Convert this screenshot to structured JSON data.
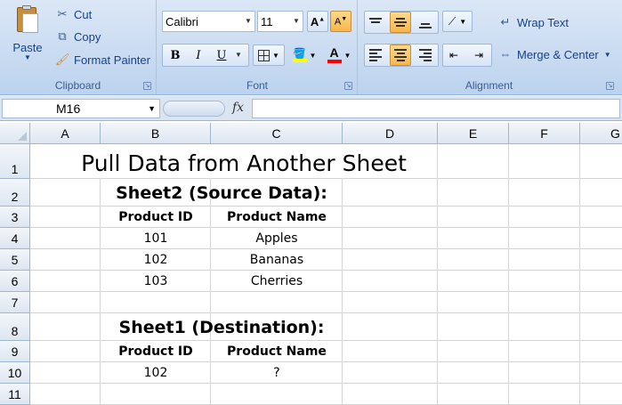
{
  "ribbon": {
    "clipboard": {
      "paste_label": "Paste",
      "cut_label": "Cut",
      "copy_label": "Copy",
      "format_painter_label": "Format Painter",
      "group_label": "Clipboard"
    },
    "font": {
      "font_name": "Calibri",
      "font_size": "11",
      "bold": "B",
      "italic": "I",
      "underline": "U",
      "highlight_color": "#ffff00",
      "font_color": "#ff0000",
      "group_label": "Font"
    },
    "alignment": {
      "wrap_text_label": "Wrap Text",
      "merge_center_label": "Merge & Center",
      "group_label": "Alignment"
    }
  },
  "formula_bar": {
    "name_box": "M16",
    "fx": "fx",
    "formula": ""
  },
  "grid": {
    "columns": [
      "A",
      "B",
      "C",
      "D",
      "E",
      "F",
      "G"
    ],
    "rows": [
      "1",
      "2",
      "3",
      "4",
      "5",
      "6",
      "7",
      "8",
      "9",
      "10",
      "11"
    ],
    "cells": {
      "title": "Pull Data from Another Sheet",
      "sheet2_heading": "Sheet2 (Source Data):",
      "src_hdr_id": "Product ID",
      "src_hdr_name": "Product Name",
      "src_r1_id": "101",
      "src_r1_name": "Apples",
      "src_r2_id": "102",
      "src_r2_name": "Bananas",
      "src_r3_id": "103",
      "src_r3_name": "Cherries",
      "sheet1_heading": "Sheet1 (Destination):",
      "dst_hdr_id": "Product ID",
      "dst_hdr_name": "Product Name",
      "dst_r1_id": "102",
      "dst_r1_name": "?"
    }
  }
}
